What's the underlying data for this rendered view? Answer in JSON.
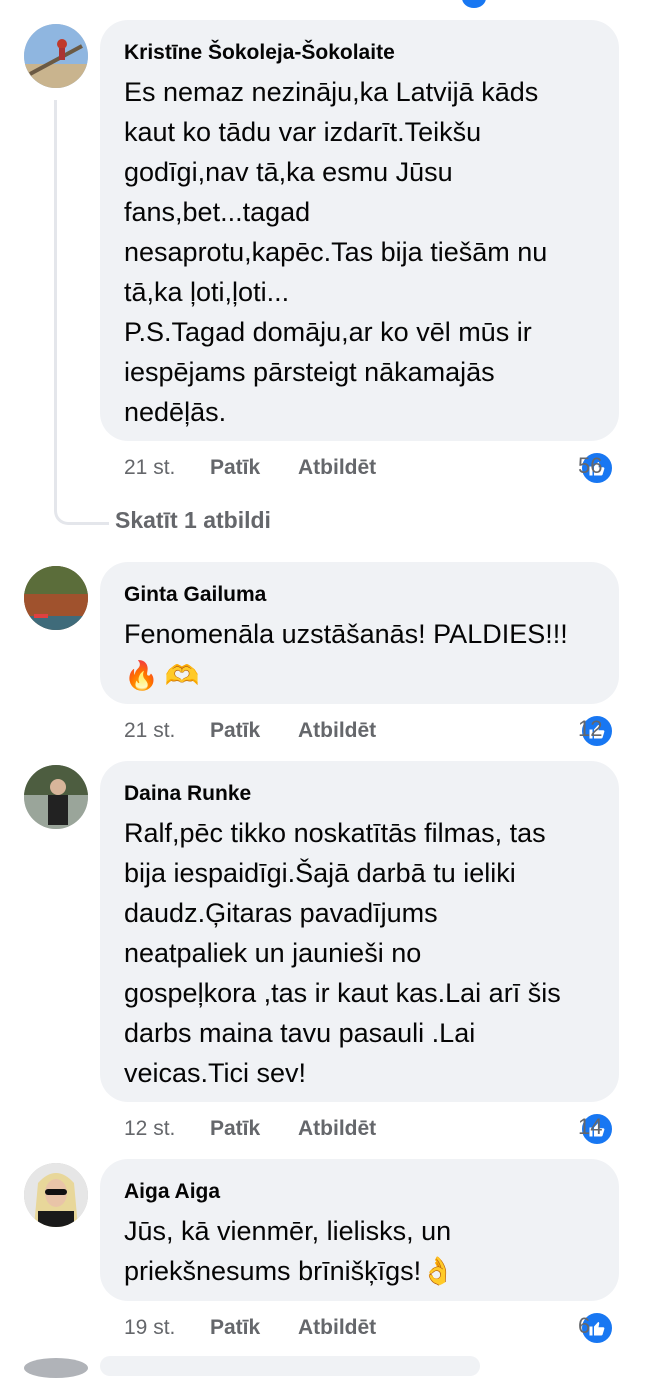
{
  "comments": [
    {
      "author": "Kristīne Šokoleja-Šokolaite",
      "text": "Es nemaz nezināju,ka Latvijā kāds\nkaut ko tādu var izdarīt.Teikšu\ngodīgi,nav tā,ka esmu Jūsu\nfans,bet...tagad\nnesaprotu,kapēc.Tas bija tiešām nu\ntā,ka ļoti,ļoti...\nP.S.Tagad domāju,ar ko vēl mūs ir\niespējams pārsteigt nākamajās\nnedēļās.",
      "time": "21 st.",
      "like_label": "Patīk",
      "reply_label": "Atbildēt",
      "reactions": "56",
      "view_replies": "Skatīt 1 atbildi"
    },
    {
      "author": "Ginta Gailuma",
      "text": "Fenomenāla uzstāšanās! PALDIES!!!",
      "emojis": [
        "🔥",
        "🫶"
      ],
      "time": "21 st.",
      "like_label": "Patīk",
      "reply_label": "Atbildēt",
      "reactions": "12"
    },
    {
      "author": "Daina Runke",
      "text": "Ralf,pēc tikko noskatītās filmas, tas\nbija iespaidīgi.Šajā darbā tu ieliki\ndaudz.Ģitaras pavadījums\nneatpaliek un jaunieši no\ngospeļkora ,tas ir kaut kas.Lai arī šis\ndarbs maina tavu pasauli .Lai\nveicas.Tici sev!",
      "time": "12 st.",
      "like_label": "Patīk",
      "reply_label": "Atbildēt",
      "reactions": "14"
    },
    {
      "author": "Aiga Aiga",
      "text": "Jūs, kā vienmēr, lielisks, un\npriekšnesums brīnišķīgs!👌",
      "time": "19 st.",
      "like_label": "Patīk",
      "reply_label": "Atbildēt",
      "reactions": "6"
    }
  ],
  "colors": {
    "bubble": "#f0f2f5",
    "meta_text": "#65676b",
    "like_blue": "#1877f2"
  },
  "icons": {
    "reaction": "thumbs-up-icon"
  }
}
